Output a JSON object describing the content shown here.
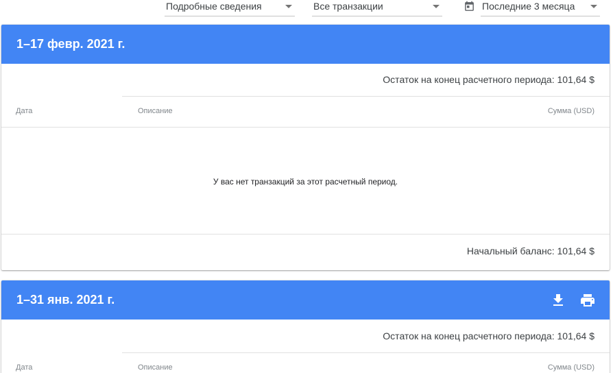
{
  "filters": {
    "view": "Подробные сведения",
    "transactions": "Все транзакции",
    "range": "Последние 3 месяца"
  },
  "statements": [
    {
      "title": "1–17 февр. 2021 г.",
      "closing_balance": "Остаток на конец расчетного периода: 101,64 $",
      "columns": {
        "date": "Дата",
        "description": "Описание",
        "amount": "Сумма (USD)"
      },
      "empty_message": "У вас нет транзакций за этот расчетный период.",
      "opening_balance": "Начальный баланс: 101,64 $"
    },
    {
      "title": "1–31 янв. 2021 г.",
      "closing_balance": "Остаток на конец расчетного периода: 101,64 $",
      "columns": {
        "date": "Дата",
        "description": "Описание",
        "amount": "Сумма (USD)"
      },
      "actions": {
        "download_icon": "download-icon",
        "print_icon": "print-icon"
      }
    }
  ],
  "colors": {
    "header_blue": "#4285f4",
    "divider": "#e0e0e0"
  }
}
